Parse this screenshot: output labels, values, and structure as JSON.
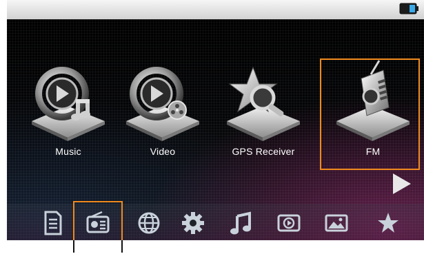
{
  "status_bar": {
    "battery_icon": "battery-icon"
  },
  "apps": [
    {
      "label": "Music",
      "icon": "music-app-icon"
    },
    {
      "label": "Video",
      "icon": "video-app-icon"
    },
    {
      "label": "GPS Receiver",
      "icon": "gps-receiver-app-icon"
    },
    {
      "label": "FM",
      "icon": "fm-app-icon",
      "selected": true
    }
  ],
  "dock": [
    {
      "icon": "document-icon"
    },
    {
      "icon": "radio-icon",
      "selected": true
    },
    {
      "icon": "globe-icon"
    },
    {
      "icon": "settings-gear-icon"
    },
    {
      "icon": "music-note-icon"
    },
    {
      "icon": "video-play-icon"
    },
    {
      "icon": "picture-icon"
    },
    {
      "icon": "star-icon"
    }
  ],
  "colors": {
    "highlight": "#f08a1c",
    "label_text": "#ffffff",
    "dock_icon": "#c9d2db",
    "battery_level": "#3aa9e8"
  }
}
